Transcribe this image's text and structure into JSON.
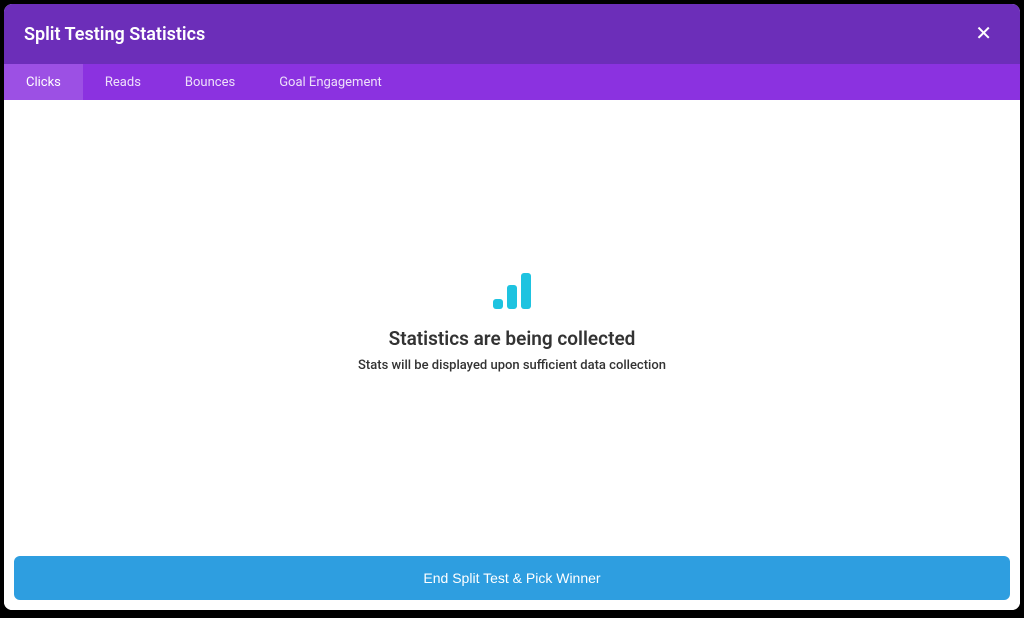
{
  "header": {
    "title": "Split Testing Statistics",
    "close_label": "✕"
  },
  "tabs": [
    {
      "label": "Clicks",
      "active": true
    },
    {
      "label": "Reads",
      "active": false
    },
    {
      "label": "Bounces",
      "active": false
    },
    {
      "label": "Goal Engagement",
      "active": false
    }
  ],
  "empty_state": {
    "heading": "Statistics are being collected",
    "subtext": "Stats will be displayed upon sufficient data collection"
  },
  "footer": {
    "button_label": "End Split Test & Pick Winner"
  },
  "colors": {
    "header_bg": "#6c2eb9",
    "tabs_bg": "#8b32e0",
    "accent": "#1ec3e0",
    "footer_btn": "#2e9ee0"
  }
}
